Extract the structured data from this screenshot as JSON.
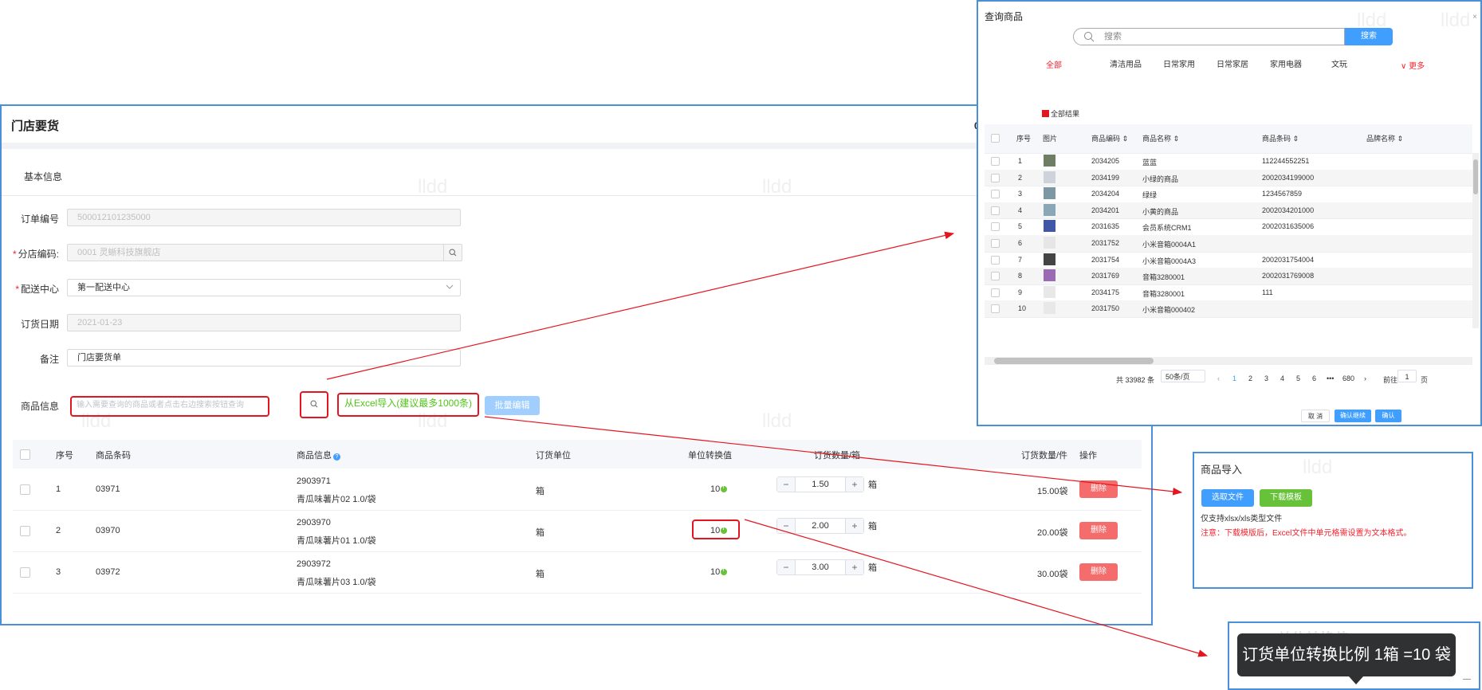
{
  "store_order": {
    "title": "门店要货",
    "title_right": "0",
    "section_basic": "基本信息",
    "fields": {
      "order_no_label": "订单编号",
      "order_no_value": "500012101235000",
      "branch_code_label": "分店编码:",
      "branch_code_value": "0001 灵蜥科技旗舰店",
      "distribution_label": "配送中心",
      "distribution_value": "第一配送中心",
      "order_date_label": "订货日期",
      "order_date_value": "2021-01-23",
      "remark_label": "备注",
      "remark_value": "门店要货单"
    },
    "goods_info_label": "商品信息",
    "goods_input_placeholder": "输入需要查询的商品或者点击右边搜索按钮查询",
    "excel_import_link": "从Excel导入(建议最多1000条)",
    "batch_edit_button": "批量编辑",
    "table_headers": [
      "序号",
      "商品条码",
      "商品信息",
      "订货单位",
      "单位转换值",
      "订货数量/箱",
      "订货数量/件",
      "操作"
    ],
    "rows": [
      {
        "no": "1",
        "barcode": "03971",
        "code": "2903971",
        "name": "青瓜味薯片02 1.0/袋",
        "unit": "箱",
        "conversion": "10",
        "qty": "1.50",
        "qty_unit": "箱",
        "pieces": "15.00袋",
        "action": "删除"
      },
      {
        "no": "2",
        "barcode": "03970",
        "code": "2903970",
        "name": "青瓜味薯片01 1.0/袋",
        "unit": "箱",
        "conversion": "10",
        "qty": "2.00",
        "qty_unit": "箱",
        "pieces": "20.00袋",
        "action": "删除"
      },
      {
        "no": "3",
        "barcode": "03972",
        "code": "2903972",
        "name": "青瓜味薯片03 1.0/袋",
        "unit": "箱",
        "conversion": "10",
        "qty": "3.00",
        "qty_unit": "箱",
        "pieces": "30.00袋",
        "action": "删除"
      }
    ],
    "watermark": "lldd"
  },
  "query_goods": {
    "title": "查询商品",
    "close": "×",
    "search_placeholder": "搜索",
    "search_button": "搜索",
    "categories": [
      "全部",
      "清洁用品",
      "日常家用",
      "日常家居",
      "家用电器",
      "文玩"
    ],
    "more": "更多",
    "all_results": "全部结果",
    "headers": [
      "序号",
      "图片",
      "商品编码",
      "商品名称",
      "商品条码",
      "品牌名称"
    ],
    "rows": [
      {
        "no": "1",
        "code": "2034205",
        "name": "蓝蓝",
        "barcode": "112244552251"
      },
      {
        "no": "2",
        "code": "2034199",
        "name": "小绿的商品",
        "barcode": "2002034199000"
      },
      {
        "no": "3",
        "code": "2034204",
        "name": "绿绿",
        "barcode": "1234567859"
      },
      {
        "no": "4",
        "code": "2034201",
        "name": "小黄的商品",
        "barcode": "2002034201000"
      },
      {
        "no": "5",
        "code": "2031635",
        "name": "会员系统CRM1",
        "barcode": "2002031635006"
      },
      {
        "no": "6",
        "code": "2031752",
        "name": "小米音箱0004A1",
        "barcode": ""
      },
      {
        "no": "7",
        "code": "2031754",
        "name": "小米音箱0004A3",
        "barcode": "2002031754004"
      },
      {
        "no": "8",
        "code": "2031769",
        "name": "音箱3280001",
        "barcode": "2002031769008"
      },
      {
        "no": "9",
        "code": "2034175",
        "name": "音箱3280001",
        "barcode": "111"
      },
      {
        "no": "10",
        "code": "2031750",
        "name": "小米音箱000402",
        "barcode": ""
      }
    ],
    "pagination": {
      "total": "共 33982 条",
      "page_size": "50条/页",
      "pages": [
        "1",
        "2",
        "3",
        "4",
        "5",
        "6",
        "•••",
        "680"
      ],
      "current": "1",
      "goto_label": "前往",
      "goto_value": "1",
      "page_suffix": "页"
    },
    "buttons": {
      "cancel": "取 消",
      "confirm_continue": "确认继续",
      "confirm": "确认"
    }
  },
  "import_dialog": {
    "title": "商品导入",
    "select_file": "选取文件",
    "download_template": "下载模板",
    "note1": "仅支持xlsx/xls类型文件",
    "note2": "注意：下载模版后，Excel文件中单元格需设置为文本格式。"
  },
  "tooltip_panel": {
    "behind_text": "单位转换值",
    "tooltip": "订货单位转换比例 1箱 =10 袋",
    "corner": "—"
  },
  "colors": {
    "accent_blue": "#409eff",
    "annotation_red": "#e3161f",
    "success_green": "#67c23a",
    "danger": "#f56c6c",
    "frame_blue": "#4a90d9"
  }
}
